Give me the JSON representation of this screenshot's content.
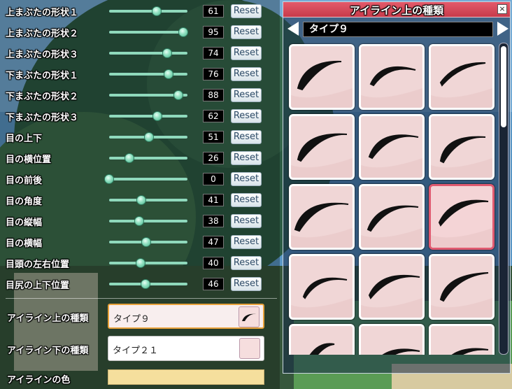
{
  "sliders": [
    {
      "label": "上まぶたの形状１",
      "value": 61,
      "reset": "Reset"
    },
    {
      "label": "上まぶたの形状２",
      "value": 95,
      "reset": "Reset"
    },
    {
      "label": "上まぶたの形状３",
      "value": 74,
      "reset": "Reset"
    },
    {
      "label": "下まぶたの形状１",
      "value": 76,
      "reset": "Reset"
    },
    {
      "label": "下まぶたの形状２",
      "value": 88,
      "reset": "Reset"
    },
    {
      "label": "下まぶたの形状３",
      "value": 62,
      "reset": "Reset"
    },
    {
      "label": "目の上下",
      "value": 51,
      "reset": "Reset"
    },
    {
      "label": "目の横位置",
      "value": 26,
      "reset": "Reset"
    },
    {
      "label": "目の前後",
      "value": 0,
      "reset": "Reset"
    },
    {
      "label": "目の角度",
      "value": 41,
      "reset": "Reset"
    },
    {
      "label": "目の縦幅",
      "value": 38,
      "reset": "Reset"
    },
    {
      "label": "目の横幅",
      "value": 47,
      "reset": "Reset"
    },
    {
      "label": "目頭の左右位置",
      "value": 40,
      "reset": "Reset"
    },
    {
      "label": "目尻の上下位置",
      "value": 46,
      "reset": "Reset"
    }
  ],
  "selectors": {
    "eyeline_upper": {
      "label": "アイライン上の種類",
      "value": "タイプ９"
    },
    "eyeline_lower": {
      "label": "アイライン下の種類",
      "value": "タイプ２１"
    },
    "eyeline_color": {
      "label": "アイラインの色",
      "color": "#f5df9d"
    }
  },
  "panel": {
    "title": "アイライン上の種類",
    "close_icon": "×",
    "current_type": "タイプ９",
    "selected_index": 8,
    "cell_count": 15
  }
}
